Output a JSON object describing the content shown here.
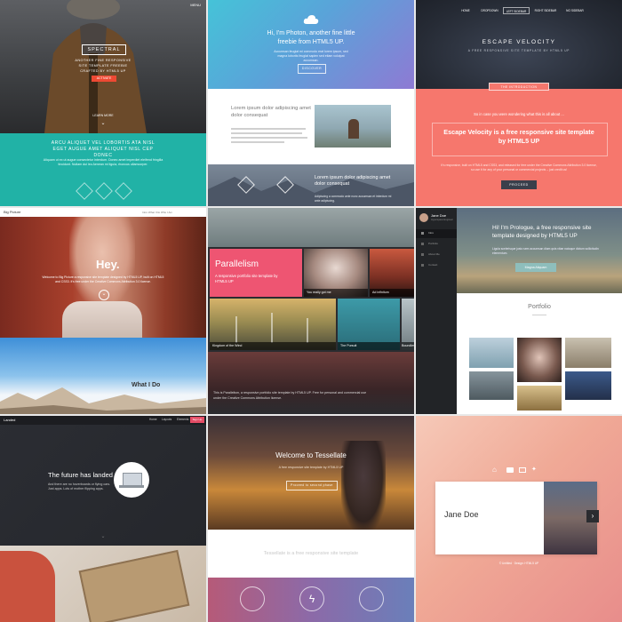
{
  "spectral": {
    "menu": "MENU",
    "title": "SPECTRAL",
    "subtitle": "ANOTHER FINE RESPONSIVE SITE TEMPLATE FREEBIE CRAFTED BY HTML5 UP",
    "cta": "ACTIVATE",
    "learn_more": "LEARN MORE",
    "band_title": "ARCU ALIQUET VEL LOBORTIS ATA NISL EGET AUGUE AMET ALIQUET NISL CEP DONEC",
    "band_text": "Aliquam ut ex ut augue consectetur interdum. Donec amet imperdiet eleifend fringilla tincidunt. Nullam dui leo Aenean mi ligula, rhoncus ullamcorper."
  },
  "photon": {
    "title": "Hi, I'm Photon, another fine little freebie from HTML5 UP.",
    "text": "Accumsan feugiat mi commodo erat lorem ipsum, sed magna lobortis feugiat sapien sed etiam volutpat accumsan.",
    "button": "DISCOVER",
    "section_title": "Lorem ipsum dolor adipiscing amet dolor consequat",
    "section2_title": "Lorem ipsum dolor adipiscing amet dolor consequat",
    "section2_text": "Adipiscing a commodo ante nunc accumsan et interdum mi ante adipiscing."
  },
  "escape": {
    "nav": [
      "HOME",
      "DROPDOWN",
      "LEFT SIDEBAR",
      "RIGHT SIDEBAR",
      "NO SIDEBAR"
    ],
    "title": "ESCAPE VELOCITY",
    "subtitle": "A FREE RESPONSIVE SITE TEMPLATE BY HTML5 UP",
    "tab": "THE INTRODUCTION",
    "intro_small": "So in case you were wondering what this is all about ...",
    "headline": "Escape Velocity is a free responsive site template by HTML5 UP",
    "text": "It's responsive, built on HTML5 and CSS3, and released for free under the Creative Commons Attribution 3.0 license, so use it for any of your personal or commercial projects – just credit us!",
    "button": "PROCEED"
  },
  "bigpicture": {
    "logo": "Big Picture",
    "nav": [
      "Intro",
      "What I Do",
      "Who I Am",
      "My Work",
      "Contact"
    ],
    "heading": "Hey.",
    "text": "Welcome to Big Picture a responsive site template designed by HTML5 UP, built on HTML5 and CSS3. It's free under the Creative Commons Attribution 3.0 license.",
    "section_title": "What I Do"
  },
  "parallelism": {
    "title": "Parallelism",
    "subtitle": "A responsive portfolio site template by HTML5 UP",
    "captions": [
      "You really got me",
      "Ad infinitum",
      "Kingdom of the Wind",
      "The Pursuit",
      "Boundless"
    ],
    "footer": "This is Parallelism, a responsive portfolio site template by HTML5 UP. Free for personal and commercial use under the Creative Commons Attribution license."
  },
  "prologue": {
    "name": "Jane Doe",
    "role": "Hyperspace Engineer",
    "nav": [
      "Intro",
      "Portfolio",
      "About Me",
      "Contact"
    ],
    "heading": "Hi! I'm Prologue, a free responsive site template designed by HTML5 UP",
    "text": "Ligula scelerisque justo sem accumsan diam quis vitae natoque dictum sollicitudin elementum.",
    "button": "Magna Aliquam",
    "section_title": "Portfolio"
  },
  "landed": {
    "logo": "Landed",
    "nav": [
      "Home",
      "Layouts",
      "Elements",
      "Sign Up"
    ],
    "title": "The future has landed",
    "text": "And there are no hoverboards or flying cars. Just apps. Lots of mother flipping apps."
  },
  "tessellate": {
    "title": "Welcome to Tessellate",
    "subtitle": "A free responsive site template by HTML5 UP",
    "button": "Proceed to second phase",
    "section_text": "Tessellate is a free responsive site template"
  },
  "identity": {
    "name": "Jane Doe",
    "footer": "© Untitled · Design: HTML5 UP",
    "icons": [
      "home-icon",
      "folder-icon",
      "envelope-icon",
      "twitter-icon"
    ]
  }
}
